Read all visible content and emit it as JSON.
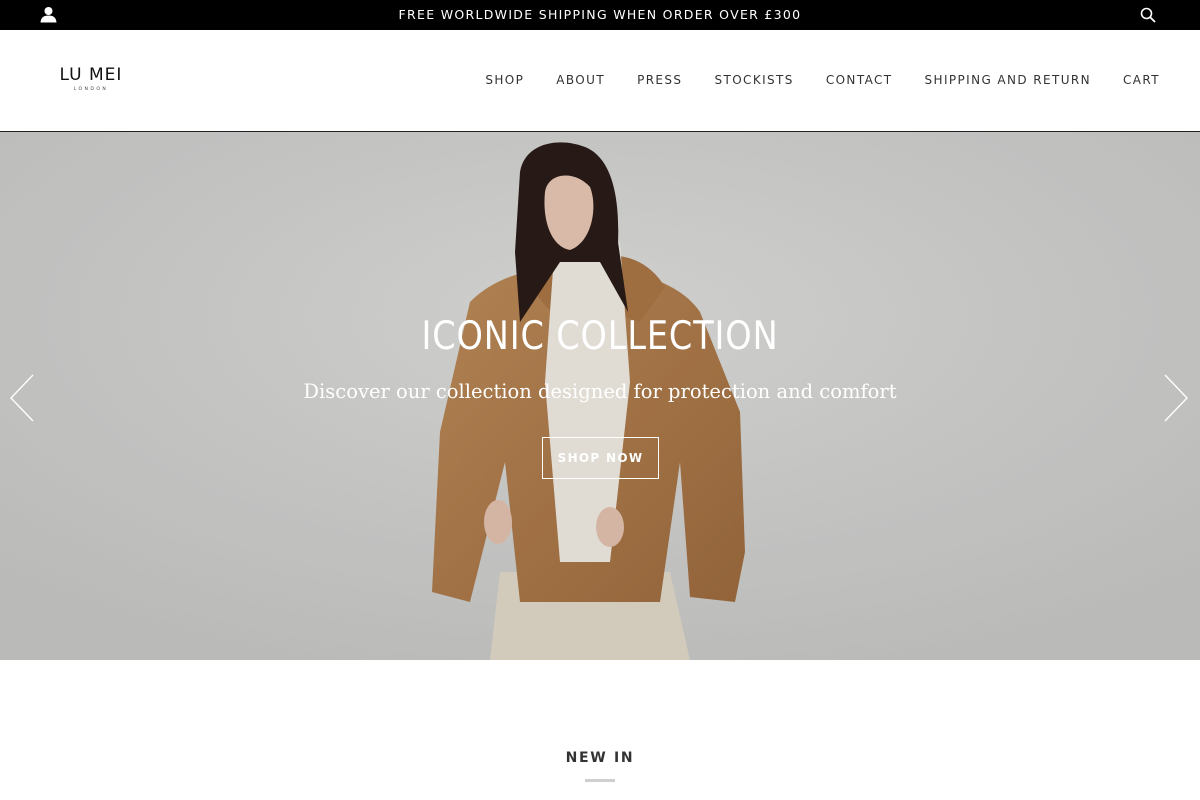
{
  "topbar": {
    "announcement": "FREE WORLDWIDE SHIPPING WHEN ORDER OVER £300",
    "account_icon": "user-icon",
    "search_icon": "search-icon"
  },
  "header": {
    "logo_name": "LU MEI",
    "logo_sub": "LONDON",
    "nav": [
      {
        "label": "SHOP"
      },
      {
        "label": "ABOUT"
      },
      {
        "label": "PRESS"
      },
      {
        "label": "STOCKISTS"
      },
      {
        "label": "CONTACT"
      },
      {
        "label": "SHIPPING AND RETURN"
      },
      {
        "label": "CART"
      }
    ]
  },
  "hero": {
    "title": "ICONIC COLLECTION",
    "subtitle": "Discover our collection designed for protection and comfort",
    "cta": "SHOP NOW",
    "prev_icon": "chevron-left-icon",
    "next_icon": "chevron-right-icon",
    "image": "model-in-camel-coat-photo"
  },
  "section": {
    "title": "NEW IN"
  },
  "colors": {
    "topbar_bg": "#000000",
    "hero_bg": "#cfcfcd",
    "coat": "#b07d4c",
    "accent_text": "#ffffff"
  }
}
